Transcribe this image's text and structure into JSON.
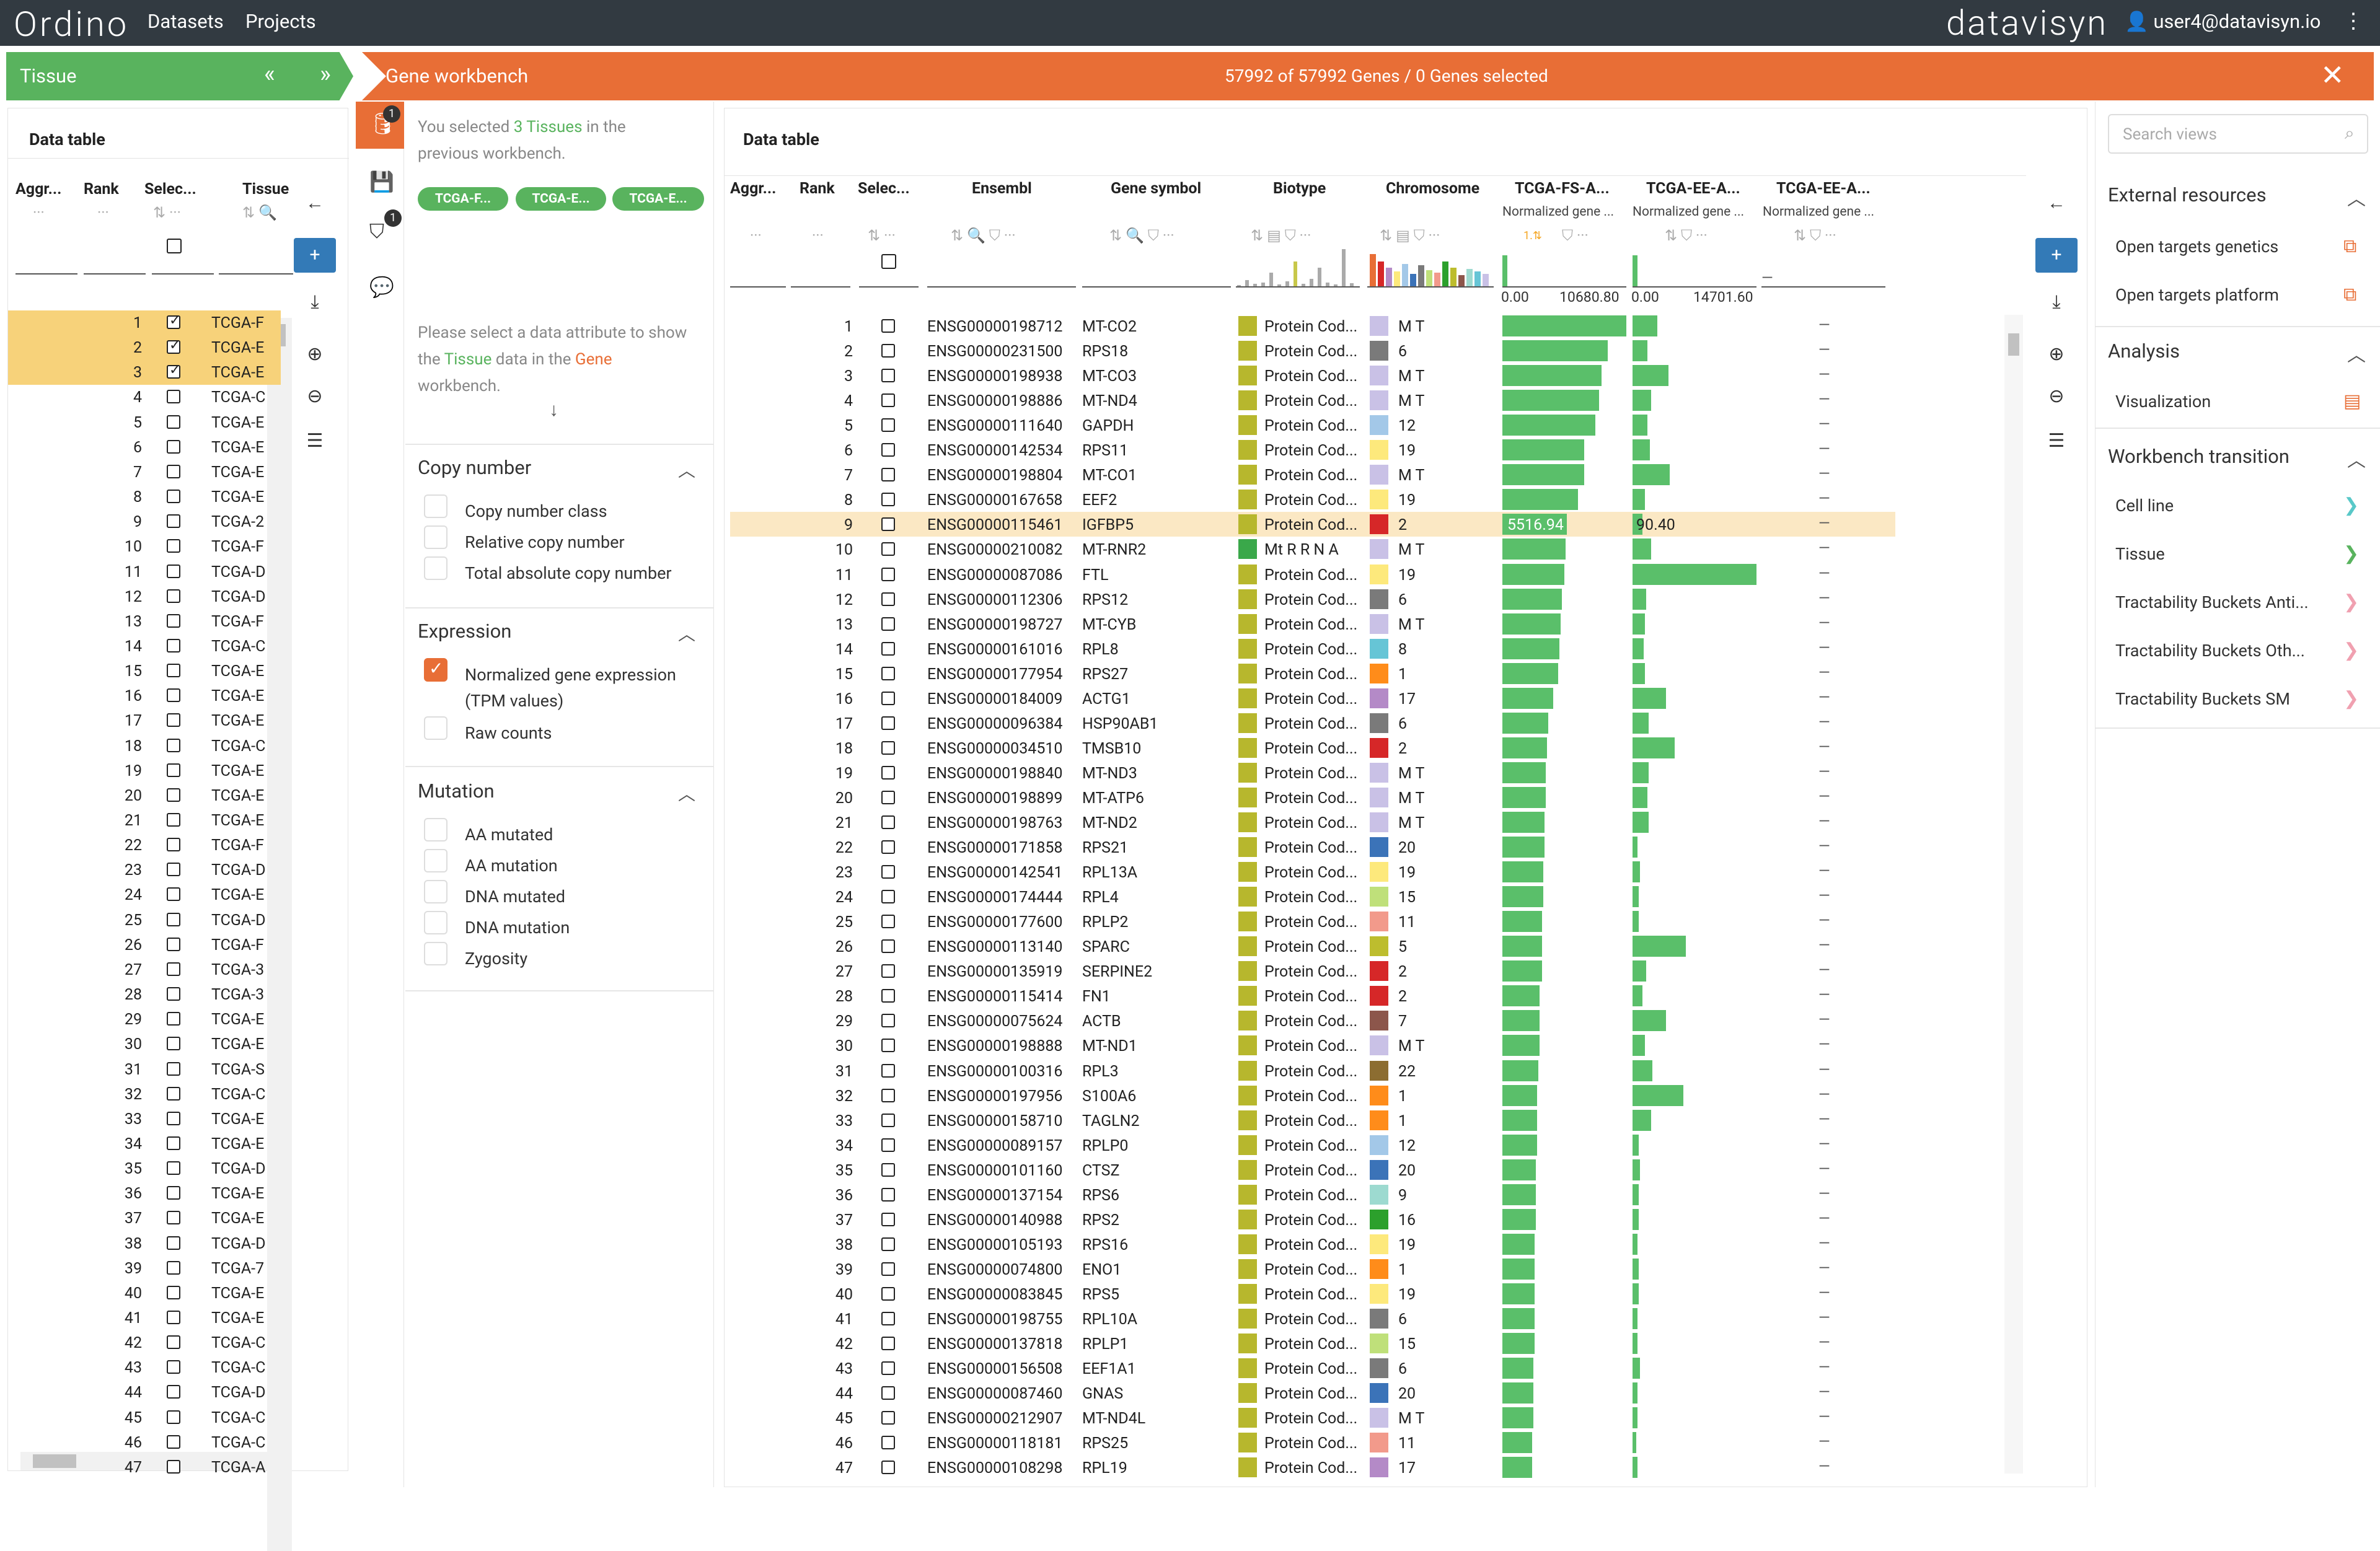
{
  "app": {
    "logo": "Ordino",
    "nav": [
      "Datasets",
      "Projects"
    ],
    "brand": "datavisyn",
    "user": "user4@datavisyn.io"
  },
  "tissue": {
    "title": "Tissue",
    "table_title": "Data table",
    "cols": [
      "Aggr...",
      "Rank",
      "Selec...",
      "Tissue"
    ],
    "rows_selected": 3,
    "cell_prefixes": [
      "TCGA-F",
      "TCGA-E",
      "TCGA-E",
      "TCGA-C",
      "TCGA-E",
      "TCGA-E",
      "TCGA-E",
      "TCGA-E",
      "TCGA-2",
      "TCGA-F",
      "TCGA-D",
      "TCGA-D",
      "TCGA-F",
      "TCGA-C",
      "TCGA-E",
      "TCGA-E",
      "TCGA-E",
      "TCGA-C",
      "TCGA-E",
      "TCGA-E",
      "TCGA-E",
      "TCGA-F",
      "TCGA-D",
      "TCGA-E",
      "TCGA-D",
      "TCGA-F",
      "TCGA-3",
      "TCGA-3",
      "TCGA-E",
      "TCGA-E",
      "TCGA-S",
      "TCGA-C",
      "TCGA-E",
      "TCGA-E",
      "TCGA-D",
      "TCGA-E",
      "TCGA-E",
      "TCGA-D",
      "TCGA-7",
      "TCGA-E",
      "TCGA-E",
      "TCGA-C",
      "TCGA-C",
      "TCGA-D",
      "TCGA-C",
      "TCGA-C",
      "TCGA-A"
    ]
  },
  "gene_wb": {
    "title": "Gene workbench",
    "count": "57992 of 57992 Genes / 0 Genes selected"
  },
  "filter": {
    "selected_pre": "You selected ",
    "selected_count": "3 Tissues",
    "selected_post": " in the previous workbench.",
    "pills": [
      "TCGA-F...",
      "TCGA-E...",
      "TCGA-E..."
    ],
    "hint_pre": "Please select a data attribute to show the ",
    "hint_tissue": "Tissue",
    "hint_mid": " data in the ",
    "hint_gene": "Gene",
    "hint_post": " workbench.",
    "sections": [
      {
        "title": "Copy number",
        "opts": [
          "Copy number class",
          "Relative copy number",
          "Total absolute copy number"
        ]
      },
      {
        "title": "Expression",
        "opts": [
          "Normalized gene expression (TPM values)",
          "Raw counts"
        ]
      },
      {
        "title": "Mutation",
        "opts": [
          "AA mutated",
          "AA mutation",
          "DNA mutated",
          "DNA mutation",
          "Zygosity"
        ]
      }
    ],
    "badges": [
      "1",
      "1"
    ]
  },
  "gene_table": {
    "title": "Data table",
    "cols": [
      "Aggr...",
      "Rank",
      "Selec...",
      "Ensembl",
      "Gene symbol",
      "Biotype",
      "Chromosome",
      "TCGA-FS-A...",
      "TCGA-EE-A...",
      "TCGA-EE-A..."
    ],
    "subcols": [
      "Normalized gene ...",
      "Normalized gene ...",
      "Normalized gene ..."
    ],
    "axis": [
      "0.00",
      "10680.80",
      "0.00",
      "14701.60"
    ],
    "highlight_vals": [
      "5516.94",
      "90.40"
    ],
    "rows": [
      [
        "ENSG00000198712",
        "MT-CO2",
        "M T"
      ],
      [
        "ENSG00000231500",
        "RPS18",
        "6"
      ],
      [
        "ENSG00000198938",
        "MT-CO3",
        "M T"
      ],
      [
        "ENSG00000198886",
        "MT-ND4",
        "M T"
      ],
      [
        "ENSG00000111640",
        "GAPDH",
        "12"
      ],
      [
        "ENSG00000142534",
        "RPS11",
        "19"
      ],
      [
        "ENSG00000198804",
        "MT-CO1",
        "M T"
      ],
      [
        "ENSG00000167658",
        "EEF2",
        "19"
      ],
      [
        "ENSG00000115461",
        "IGFBP5",
        "2"
      ],
      [
        "ENSG00000210082",
        "MT-RNR2",
        "M T"
      ],
      [
        "ENSG00000087086",
        "FTL",
        "19"
      ],
      [
        "ENSG00000112306",
        "RPS12",
        "6"
      ],
      [
        "ENSG00000198727",
        "MT-CYB",
        "M T"
      ],
      [
        "ENSG00000161016",
        "RPL8",
        "8"
      ],
      [
        "ENSG00000177954",
        "RPS27",
        "1"
      ],
      [
        "ENSG00000184009",
        "ACTG1",
        "17"
      ],
      [
        "ENSG00000096384",
        "HSP90AB1",
        "6"
      ],
      [
        "ENSG00000034510",
        "TMSB10",
        "2"
      ],
      [
        "ENSG00000198840",
        "MT-ND3",
        "M T"
      ],
      [
        "ENSG00000198899",
        "MT-ATP6",
        "M T"
      ],
      [
        "ENSG00000198763",
        "MT-ND2",
        "M T"
      ],
      [
        "ENSG00000171858",
        "RPS21",
        "20"
      ],
      [
        "ENSG00000142541",
        "RPL13A",
        "19"
      ],
      [
        "ENSG00000174444",
        "RPL4",
        "15"
      ],
      [
        "ENSG00000177600",
        "RPLP2",
        "11"
      ],
      [
        "ENSG00000113140",
        "SPARC",
        "5"
      ],
      [
        "ENSG00000135919",
        "SERPINE2",
        "2"
      ],
      [
        "ENSG00000115414",
        "FN1",
        "2"
      ],
      [
        "ENSG00000075624",
        "ACTB",
        "7"
      ],
      [
        "ENSG00000198888",
        "MT-ND1",
        "M T"
      ],
      [
        "ENSG00000100316",
        "RPL3",
        "22"
      ],
      [
        "ENSG00000197956",
        "S100A6",
        "1"
      ],
      [
        "ENSG00000158710",
        "TAGLN2",
        "1"
      ],
      [
        "ENSG00000089157",
        "RPLP0",
        "12"
      ],
      [
        "ENSG00000101160",
        "CTSZ",
        "20"
      ],
      [
        "ENSG00000137154",
        "RPS6",
        "9"
      ],
      [
        "ENSG00000140988",
        "RPS2",
        "16"
      ],
      [
        "ENSG00000105193",
        "RPS16",
        "19"
      ],
      [
        "ENSG00000074800",
        "ENO1",
        "1"
      ],
      [
        "ENSG00000083845",
        "RPS5",
        "19"
      ],
      [
        "ENSG00000198755",
        "RPL10A",
        "6"
      ],
      [
        "ENSG00000137818",
        "RPLP1",
        "15"
      ],
      [
        "ENSG00000156508",
        "EEF1A1",
        "6"
      ],
      [
        "ENSG00000087460",
        "GNAS",
        "20"
      ],
      [
        "ENSG00000212907",
        "MT-ND4L",
        "M T"
      ],
      [
        "ENSG00000118181",
        "RPS25",
        "11"
      ],
      [
        "ENSG00000108298",
        "RPL19",
        "17"
      ]
    ],
    "biotype_default": "Protein Cod...",
    "biotype_row10": "Mt R R N A",
    "bar1": [
      1.0,
      0.85,
      0.8,
      0.78,
      0.75,
      0.66,
      0.66,
      0.61,
      0.52,
      0.51,
      0.5,
      0.48,
      0.47,
      0.46,
      0.45,
      0.41,
      0.37,
      0.36,
      0.35,
      0.35,
      0.34,
      0.34,
      0.33,
      0.33,
      0.32,
      0.32,
      0.32,
      0.3,
      0.3,
      0.3,
      0.29,
      0.28,
      0.28,
      0.28,
      0.27,
      0.27,
      0.27,
      0.26,
      0.26,
      0.26,
      0.26,
      0.26,
      0.25,
      0.25,
      0.25,
      0.24,
      0.24
    ],
    "bar2": [
      0.2,
      0.12,
      0.29,
      0.15,
      0.12,
      0.14,
      0.3,
      0.1,
      0.08,
      0.15,
      1.0,
      0.11,
      0.1,
      0.09,
      0.1,
      0.27,
      0.13,
      0.34,
      0.13,
      0.12,
      0.13,
      0.04,
      0.06,
      0.05,
      0.05,
      0.43,
      0.11,
      0.08,
      0.27,
      0.1,
      0.16,
      0.41,
      0.15,
      0.05,
      0.06,
      0.05,
      0.05,
      0.04,
      0.05,
      0.05,
      0.04,
      0.04,
      0.06,
      0.04,
      0.04,
      0.03,
      0.04
    ],
    "chrom_colors": {
      "M T": "#c9c1e6",
      "6": "#7a7a7a",
      "12": "#a3c8e8",
      "19": "#fde97c",
      "2": "#d62728",
      "8": "#66c5d6",
      "1": "#ff8c1a",
      "17": "#b48ac7",
      "20": "#3b73b8",
      "15": "#bfe07a",
      "11": "#f29a8b",
      "5": "#bdbd2e",
      "7": "#8c564b",
      "22": "#8c6d31",
      "9": "#9ddad0",
      "16": "#2ca02c"
    }
  },
  "right": {
    "search_placeholder": "Search views",
    "sections": [
      {
        "title": "External resources",
        "items": [
          "Open targets genetics",
          "Open targets platform"
        ]
      },
      {
        "title": "Analysis",
        "items": [
          "Visualization"
        ]
      },
      {
        "title": "Workbench transition",
        "items": [
          "Cell line",
          "Tissue",
          "Tractability Buckets Anti...",
          "Tractability Buckets Oth...",
          "Tractability Buckets SM"
        ]
      }
    ]
  }
}
